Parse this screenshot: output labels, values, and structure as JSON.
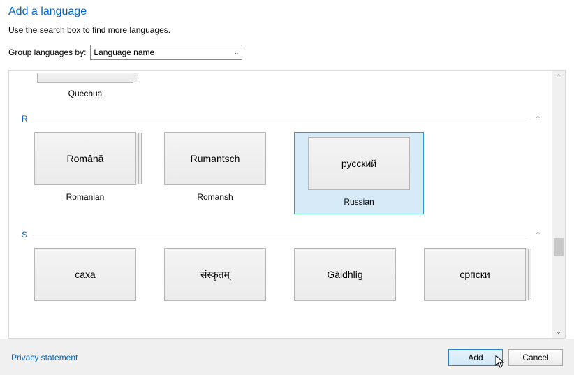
{
  "title": "Add a language",
  "subtitle": "Use the search box to find more languages.",
  "group_by": {
    "label": "Group languages by:",
    "selected": "Language name"
  },
  "sections": {
    "prev": {
      "last_label": "Quechua"
    },
    "r": {
      "letter": "R",
      "items": [
        {
          "native": "Română",
          "english": "Romanian",
          "stacked": true,
          "selected": false
        },
        {
          "native": "Rumantsch",
          "english": "Romansh",
          "stacked": false,
          "selected": false
        },
        {
          "native": "русский",
          "english": "Russian",
          "stacked": false,
          "selected": true
        }
      ]
    },
    "s": {
      "letter": "S",
      "items": [
        {
          "native": "саха",
          "stacked": false
        },
        {
          "native": "संस्कृतम्",
          "stacked": false
        },
        {
          "native": "Gàidhlig",
          "stacked": false
        },
        {
          "native": "српски",
          "stacked": true
        }
      ]
    }
  },
  "footer": {
    "privacy": "Privacy statement",
    "add": "Add",
    "cancel": "Cancel"
  }
}
